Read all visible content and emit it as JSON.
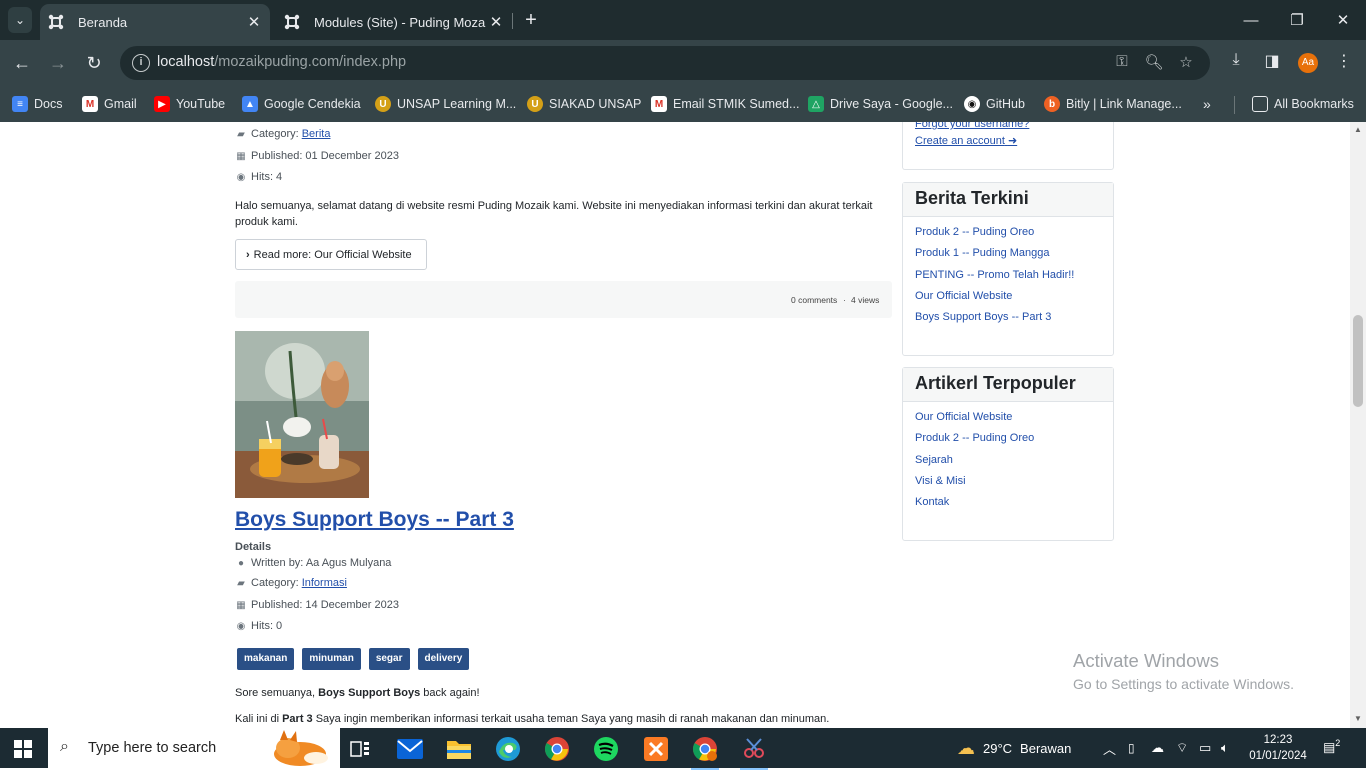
{
  "browser": {
    "tabs": [
      {
        "title": "Beranda",
        "active": true
      },
      {
        "title": "Modules (Site) - Puding Mozaik",
        "active": false
      }
    ],
    "url_host": "localhost",
    "url_path": "/mozaikpuding.com/index.php",
    "profile_initials": "Aa",
    "bookmarks": [
      "Docs",
      "Gmail",
      "YouTube",
      "Google Cendekia",
      "UNSAP Learning M...",
      "SIAKAD UNSAP",
      "Email STMIK Sumed...",
      "Drive Saya - Google...",
      "GitHub",
      "Bitly | Link Manage..."
    ],
    "all_bookmarks": "All Bookmarks"
  },
  "article1": {
    "category_label": "Category:",
    "category_value": "Berita",
    "published": "Published: 01 December 2023",
    "hits": "Hits: 4",
    "intro": "Halo semuanya, selamat datang di website resmi Puding Mozaik kami. Website ini menyediakan informasi terkini dan akurat terkait produk kami.",
    "read_more": "Read more: Our Official Website",
    "comments": "0 comments",
    "views": "4 views"
  },
  "article2": {
    "title": "Boys Support Boys -- Part 3",
    "details": "Details",
    "author": "Written by: Aa Agus Mulyana",
    "category_label": "Category:",
    "category_value": "Informasi",
    "published": "Published: 14 December 2023",
    "hits": "Hits: 0",
    "tags": [
      "makanan",
      "minuman",
      "segar",
      "delivery"
    ],
    "p1_pre": "Sore semuanya, ",
    "p1_bold": "Boys Support Boys",
    "p1_post": " back again!",
    "p2_pre": "Kali ini di ",
    "p2_bold": "Part 3",
    "p2_post": " Saya ingin memberikan informasi terkait usaha teman Saya yang masih di ranah makanan dan minuman."
  },
  "sidebar": {
    "login_links": [
      "Forgot your username?",
      "Create an account"
    ],
    "berita": {
      "title": "Berita Terkini",
      "items": [
        "Produk 2 -- Puding Oreo",
        "Produk 1 -- Puding Mangga",
        "PENTING -- Promo Telah Hadir!!",
        "Our Official Website",
        "Boys Support Boys -- Part 3"
      ]
    },
    "populer": {
      "title": "Artikerl Terpopuler",
      "items": [
        "Our Official Website",
        "Produk 2 -- Puding Oreo",
        "Sejarah",
        "Visi & Misi",
        "Kontak"
      ]
    }
  },
  "watermark": {
    "line1": "Activate Windows",
    "line2": "Go to Settings to activate Windows."
  },
  "taskbar": {
    "search_placeholder": "Type here to search",
    "weather_temp": "29°C",
    "weather_desc": "Berawan",
    "time": "12:23",
    "date": "01/01/2024",
    "notifications": "2"
  },
  "colors": {
    "link": "#224faa",
    "tag": "#2a4f86",
    "chrome_dark": "#1f2c2f",
    "chrome_toolbar": "#354448",
    "taskbar": "#1c2b33"
  }
}
